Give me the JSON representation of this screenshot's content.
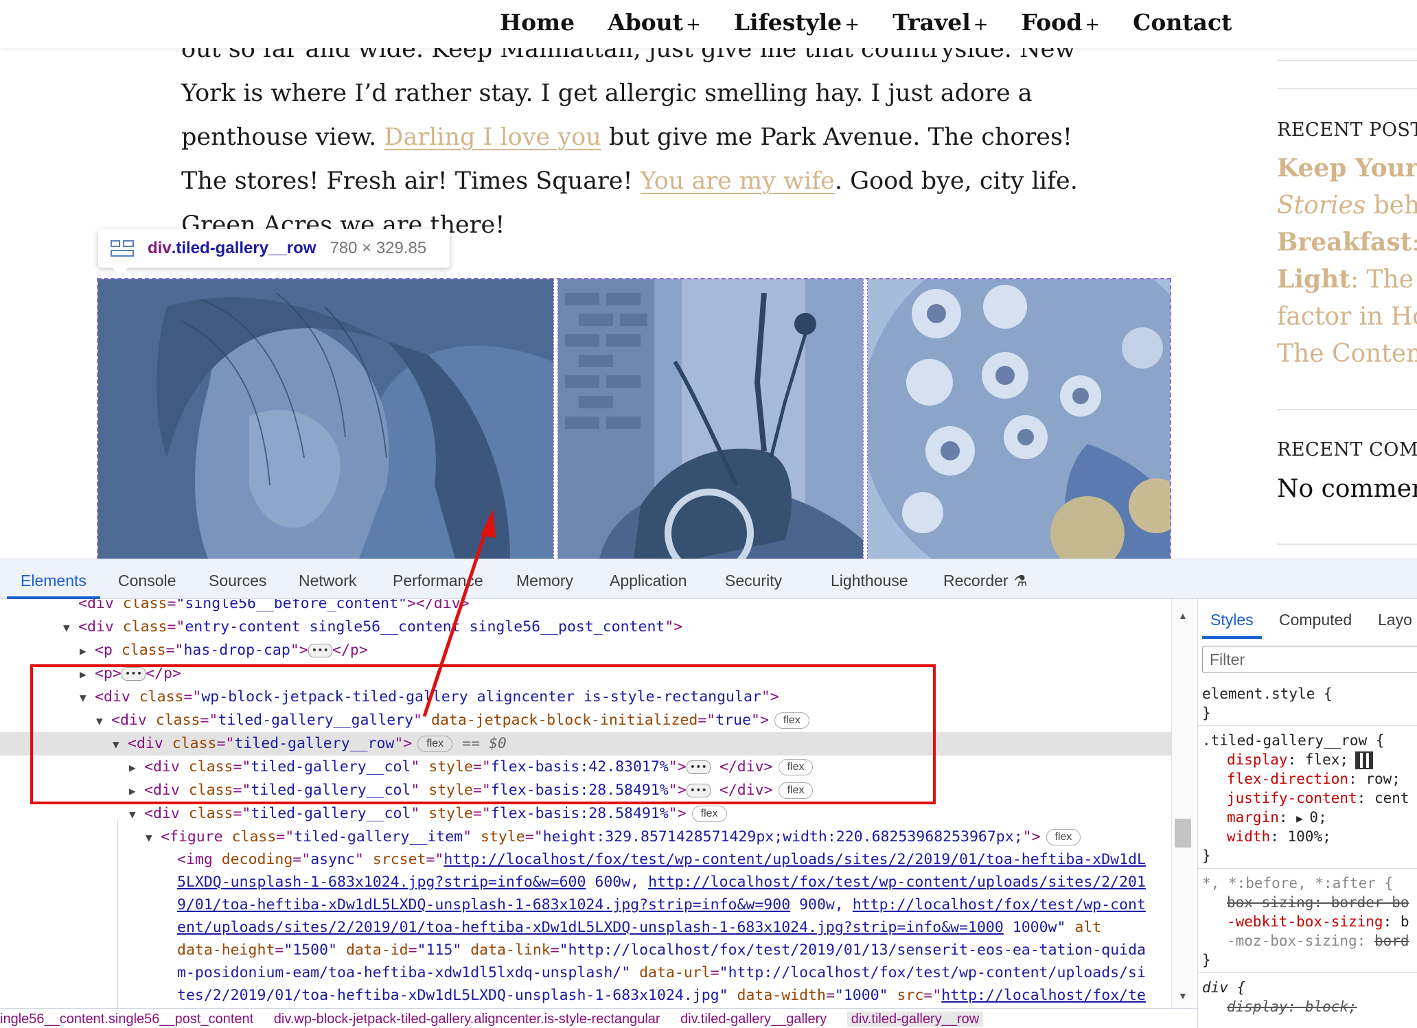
{
  "nav": {
    "items": [
      {
        "label": "Home",
        "plus": ""
      },
      {
        "label": "About",
        "plus": "+"
      },
      {
        "label": "Lifestyle",
        "plus": "+"
      },
      {
        "label": "Travel",
        "plus": "+"
      },
      {
        "label": "Food",
        "plus": "+"
      },
      {
        "label": "Contact",
        "plus": ""
      }
    ]
  },
  "article": {
    "line0": "out so far and wide. Keep Manhattan, just give me that countryside. New",
    "line1": "York is where I’d rather stay. I get allergic smelling hay. I just adore a",
    "line2_a": "penthouse view. ",
    "line2_link": "Darling I love you",
    "line2_b": " but give me Park Avenue. The chores!",
    "line3_a": "The stores! Fresh air! Times Square! ",
    "line3_link": "You are my wife",
    "line3_b": ". Good bye, city life.",
    "line4": "Green Acres we are there!"
  },
  "tooltip": {
    "tag": "div",
    "cls": ".tiled-gallery__row",
    "size": "780 × 329.85"
  },
  "sidebar": {
    "recent_posts_heading": "RECENT POSTS",
    "posts": [
      {
        "bold": "Keep Your F",
        "rest": ""
      },
      {
        "italic": "Stories",
        "rest": " behi"
      },
      {
        "bold": "Breakfast",
        "rest": ": a"
      },
      {
        "bold": "Light",
        "rest": ": The r"
      },
      {
        "bold": "",
        "rest": "factor in Ho"
      },
      {
        "bold": "",
        "rest": "The Contem"
      }
    ],
    "recent_comments_heading": "RECENT COMM",
    "no_comments": "No commen"
  },
  "devtools": {
    "tabs": [
      "Elements",
      "Console",
      "Sources",
      "Network",
      "Performance",
      "Memory",
      "Application",
      "Security",
      "Lighthouse",
      "Recorder"
    ],
    "active_tab": "Elements",
    "styles_tabs": [
      "Styles",
      "Computed",
      "Layo"
    ],
    "filter_placeholder": "Filter",
    "dom": {
      "l0": "<div class=\"single56__before_content\"></div>",
      "l1_val": "entry-content single56__content single56__post_content",
      "l2_val": "has-drop-cap",
      "l4_val": "wp-block-jetpack-tiled-gallery aligncenter is-style-rectangular",
      "l5_val": "tiled-gallery__gallery",
      "l5_attr2": "data-jetpack-block-initialized",
      "l5_val2": "true",
      "l6_val": "tiled-gallery__row",
      "l6_eq": "== $0",
      "col_val": "tiled-gallery__col",
      "col1_style": "flex-basis:42.83017%",
      "col2_style": "flex-basis:28.58491%",
      "col3_style": "flex-basis:28.58491%",
      "fig_val": "tiled-gallery__item",
      "fig_style": "height:329.8571428571429px;width:220.68253968253967px;",
      "img_decoding": "async",
      "src1": "http://localhost/fox/test/wp-content/uploads/sites/2/2019/01/toa-heftiba-xDw1dL",
      "src2": "5LXDQ-unsplash-1-683x1024.jpg?strip=info&w=600",
      "src2b": "600w, ",
      "src2c": "http://localhost/fox/test/wp-content/uploads/sites/2/201",
      "src3": "9/01/toa-heftiba-xDw1dL5LXDQ-unsplash-1-683x1024.jpg?strip=info&w=900",
      "src3b": " 900w, ",
      "src3c": "http://localhost/fox/test/wp-cont",
      "src4": "ent/uploads/sites/2/2019/01/toa-heftiba-xDw1dL5LXDQ-unsplash-1-683x1024.jpg?strip=info&w=1000",
      "src4b": " 1000w\"",
      "src4c": " alt",
      "l12_a": "data-height",
      "l12_av": "\"1500\"",
      "l12_b": "data-id",
      "l12_bv": "\"115\"",
      "l12_c": "data-link",
      "l12_cv": "\"http://localhost/fox/test/2019/01/13/senserit-eos-ea-tation-quida",
      "l13_cv": "m-posidonium-eam/toa-heftiba-xdw1dl5lxdq-unsplash/\"",
      "l13_d": "data-url",
      "l13_dv": "\"http://localhost/fox/test/wp-content/uploads/si",
      "l14_dv": "tes/2/2019/01/toa-heftiba-xDw1dL5LXDQ-unsplash-1-683x1024.jpg\"",
      "l14_e": "data-width",
      "l14_ev": "\"1000\"",
      "l14_f": "src",
      "l14_fv": "http://localhost/fox/te"
    },
    "badges": {
      "flex": "flex"
    },
    "styles": {
      "r1_sel": "element.style {",
      "r1_close": "}",
      "r2_sel": ".tiled-gallery__row {",
      "r2_p1": "display",
      "r2_v1": "flex;",
      "r2_p2": "flex-direction",
      "r2_v2": "row;",
      "r2_p3": "justify-content",
      "r2_v3": "cent",
      "r2_p4": "margin",
      "r2_v4": "0;",
      "r2_p5": "width",
      "r2_v5": "100%;",
      "r2_close": "}",
      "r3_sel": "*, *:before, *:after {",
      "r3_p1": "box-sizing",
      "r3_v1": "border-bo",
      "r3_p2": "-webkit-box-sizing",
      "r3_v2": "b",
      "r3_p3": "-moz-box-sizing",
      "r3_v3": "bord",
      "r3_close": "}",
      "r4_sel": "div {",
      "r4_p1": "display",
      "r4_v1": "block;"
    },
    "breadcrumbs": [
      "ingle56__content.single56__post_content",
      "div.wp-block-jetpack-tiled-gallery.aligncenter.is-style-rectangular",
      "div.tiled-gallery__gallery",
      "div.tiled-gallery__row"
    ]
  },
  "colors": {
    "link": "#d4b58a",
    "overlay": "#6f8fbf",
    "annotation": "#e01010",
    "devtools_active": "#1a5fd0"
  }
}
